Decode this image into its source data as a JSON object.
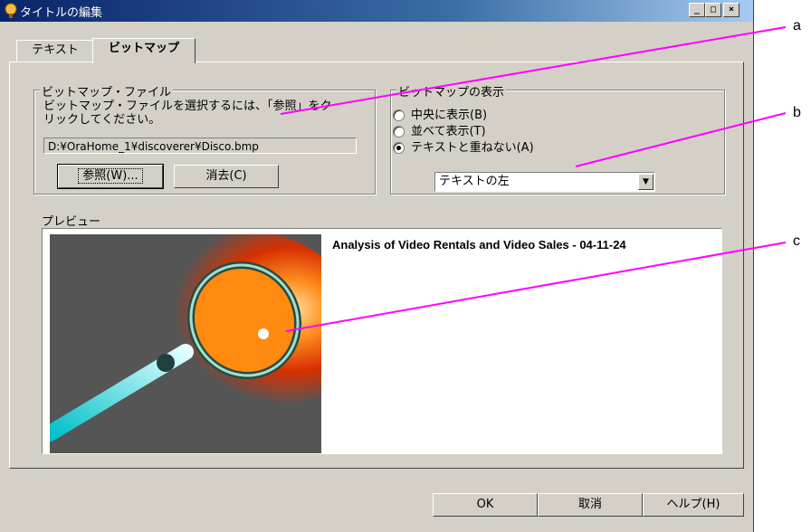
{
  "window": {
    "title": "タイトルの編集",
    "controls": {
      "minimize": "_",
      "maximize": "□",
      "close": "×"
    }
  },
  "tabs": [
    {
      "label": "テキスト",
      "active": false
    },
    {
      "label": "ビットマップ",
      "active": true
    }
  ],
  "bitmap_file": {
    "legend": "ビットマップ・ファイル",
    "description": "ビットマップ・ファイルを選択するには、「参照」をクリックしてください。",
    "path": "D:¥OraHome_1¥discoverer¥Disco.bmp",
    "browse_label": "参照(W)...",
    "clear_label": "消去(C)"
  },
  "bitmap_display": {
    "legend": "ビットマップの表示",
    "options": [
      {
        "label": "中央に表示(B)",
        "checked": false
      },
      {
        "label": "並べて表示(T)",
        "checked": false
      },
      {
        "label": "テキストと重ねない(A)",
        "checked": true
      }
    ],
    "position_selected": "テキストの左"
  },
  "preview": {
    "label": "プレビュー",
    "title": "Analysis of Video Rentals and Video Sales - 04-11-24"
  },
  "footer": {
    "ok_label": "OK",
    "cancel_label": "取消",
    "help_label": "ヘルプ(H)"
  },
  "callouts": {
    "a": "a",
    "b": "b",
    "c": "c"
  },
  "colors": {
    "dialog_bg": "#d4d0c8",
    "titlebar_start": "#0a246a",
    "titlebar_end": "#a6caf0",
    "callout_line": "#ff00ff"
  },
  "icons": {
    "title": "app-icon",
    "select_arrow": "chevron-down-icon",
    "preview_image": "magnifier-image"
  }
}
